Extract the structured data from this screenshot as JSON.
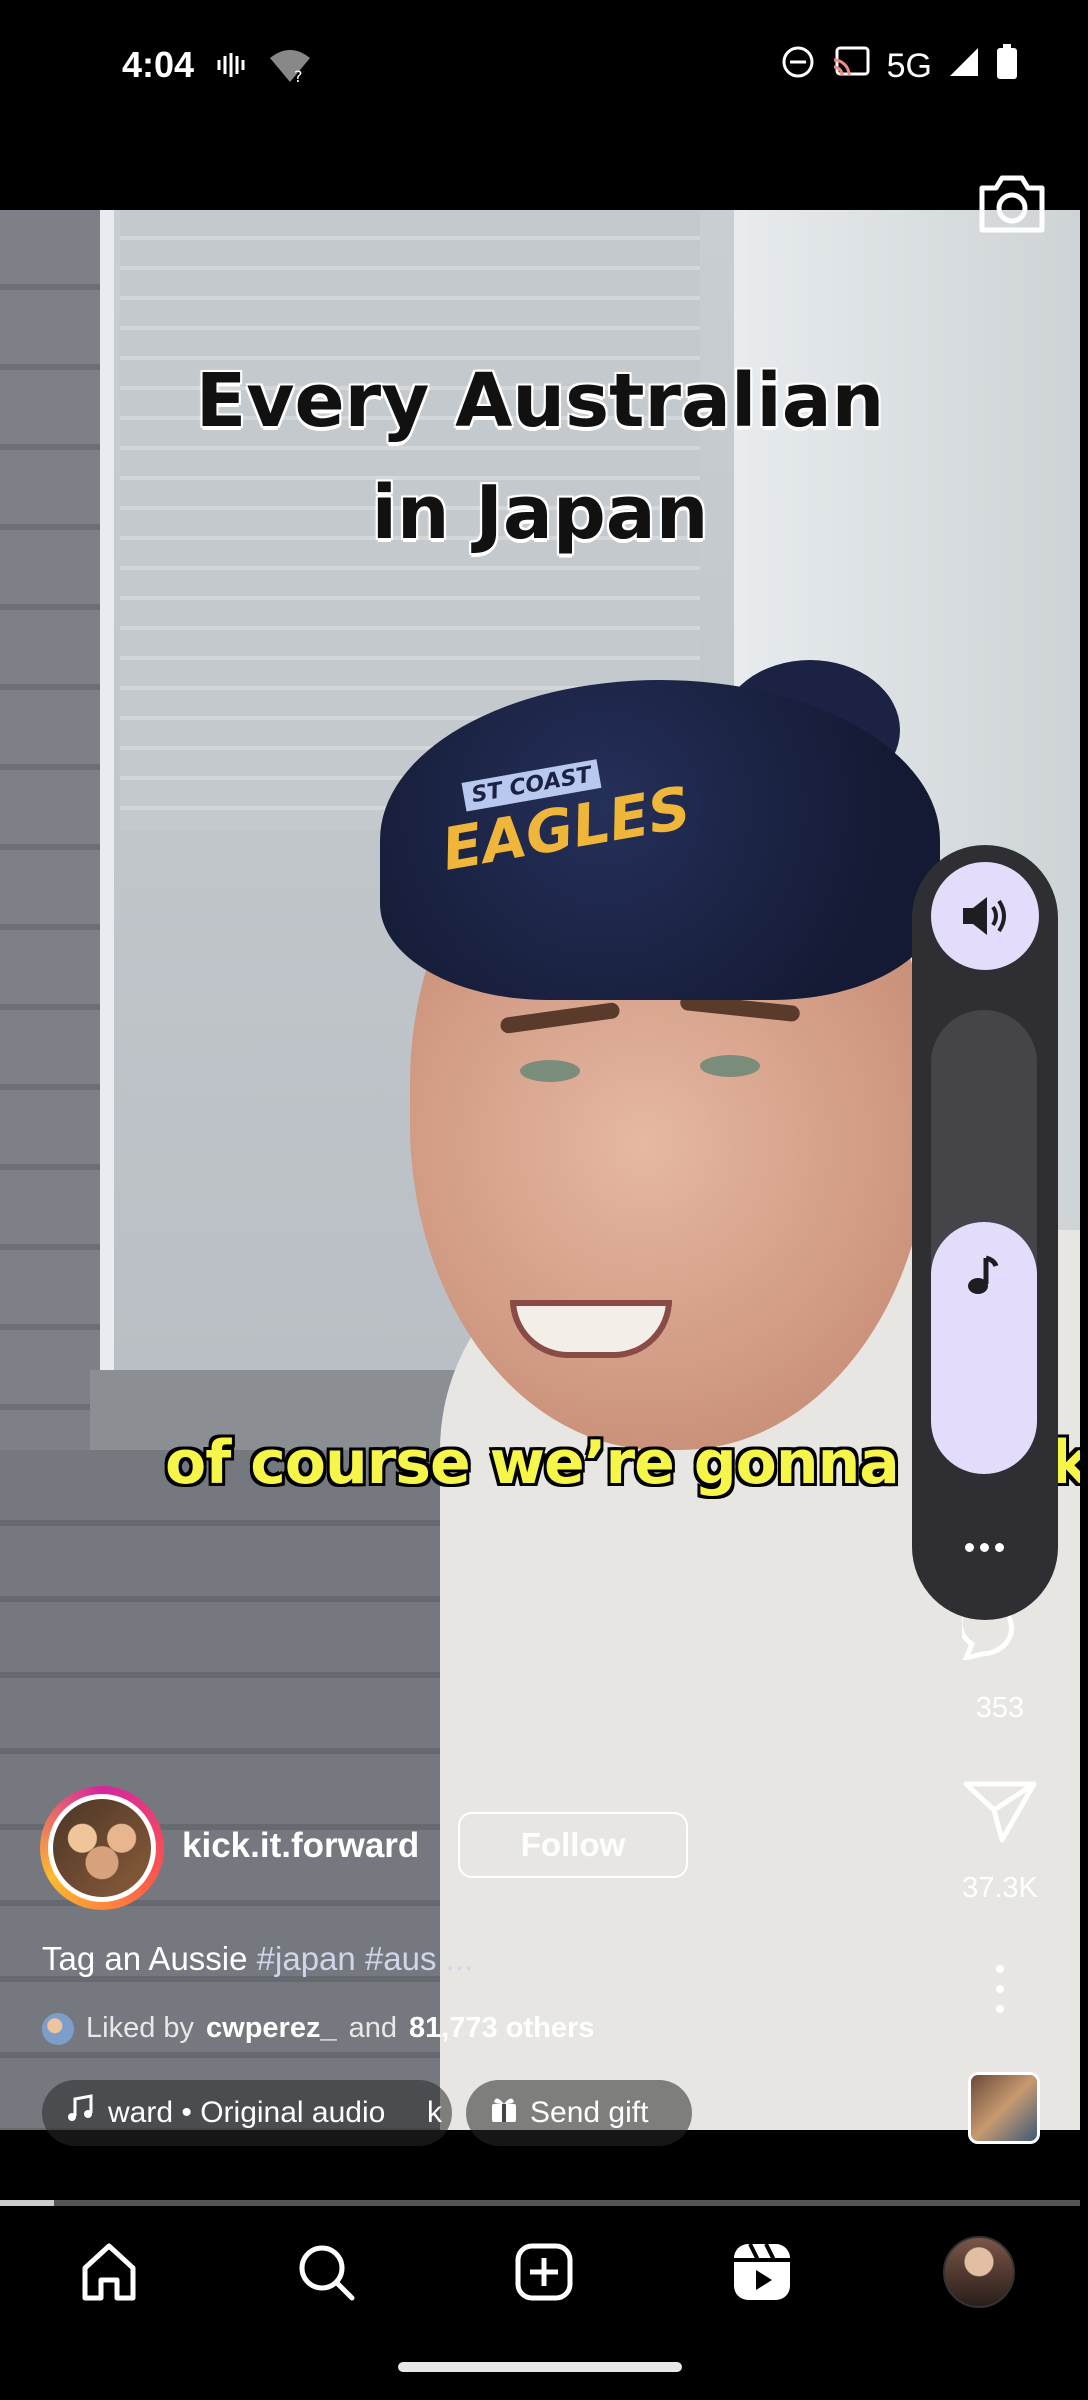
{
  "status_bar": {
    "time": "4:04",
    "network": "5G"
  },
  "video": {
    "headline_line1": "Every Australian",
    "headline_line2": "in Japan",
    "subtitle": "of course we’re gonna drink",
    "beanie_text_top": "ST COAST",
    "beanie_text_main": "EAGLES"
  },
  "rail": {
    "comments_count": "353",
    "shares_count": "37.3K"
  },
  "post": {
    "username": "kick.it.forward",
    "follow_label": "Follow",
    "caption_text": "Tag an Aussie",
    "caption_tags": "#japan #aus ...",
    "liked_prefix": "Liked by",
    "liked_user": "cwperez_",
    "liked_and": "and",
    "liked_others": "81,773 others",
    "audio_label": "ward • Original audio     k",
    "gift_label": "Send gift"
  },
  "progress": {
    "fraction": 0.05
  },
  "nav": {
    "items": [
      "home-icon",
      "search-icon",
      "create-icon",
      "reels-icon",
      "profile-avatar"
    ]
  },
  "colors": {
    "volume_accent": "#e4dcfb",
    "panel_bg": "#2f2f33",
    "subtitle_yellow": "#f6f64a"
  }
}
